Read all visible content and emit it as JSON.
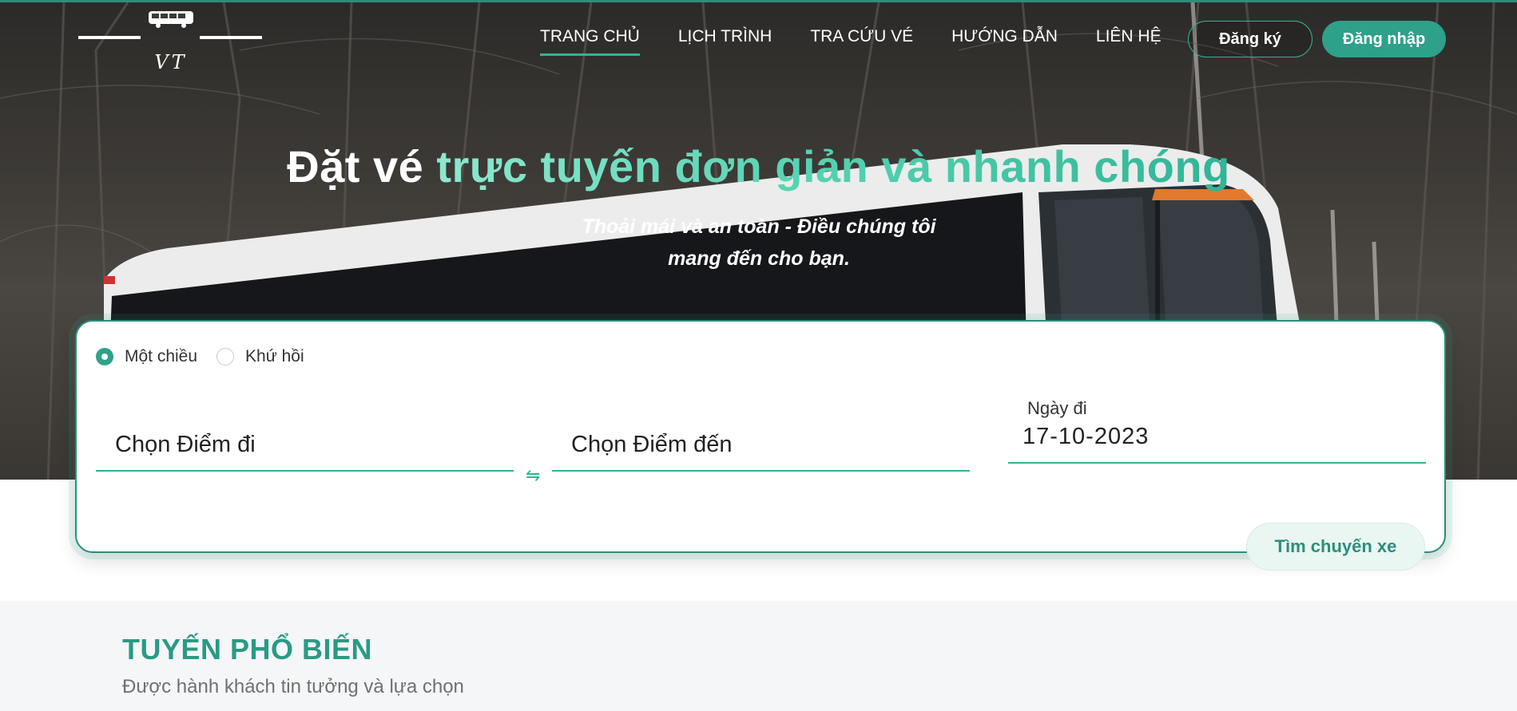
{
  "logo": {
    "text": "VT",
    "icon": "bus-icon"
  },
  "nav": {
    "items": [
      "TRANG CHỦ",
      "LỊCH TRÌNH",
      "TRA CỨU VÉ",
      "HƯỚNG DẪN",
      "LIÊN HỆ"
    ],
    "active_index": 0,
    "register_label": "Đăng ký",
    "login_label": "Đăng nhập"
  },
  "hero": {
    "headline_white": "Đặt vé ",
    "headline_green": "trực tuyến đơn giản và nhanh chóng",
    "subtitle": "Thoải mái và an toàn - Điều chúng tôi mang đến cho bạn."
  },
  "search": {
    "trip_types": [
      "Một chiều",
      "Khứ hồi"
    ],
    "selected_trip_type": "Một chiều",
    "from_placeholder": "Chọn Điểm đi",
    "to_placeholder": "Chọn Điểm đến",
    "swap_icon": "swap-arrows-icon",
    "date_label": "Ngày đi",
    "date_value": "17-10-2023",
    "find_button": "Tìm chuyến xe"
  },
  "popular": {
    "title": "TUYẾN PHỔ BIẾN",
    "subtitle": "Được hành khách tin tưởng và lựa chọn"
  },
  "colors": {
    "accent": "#2ea18a",
    "accent_light": "#53d1b0",
    "hero_bg": "#3d3a36"
  }
}
